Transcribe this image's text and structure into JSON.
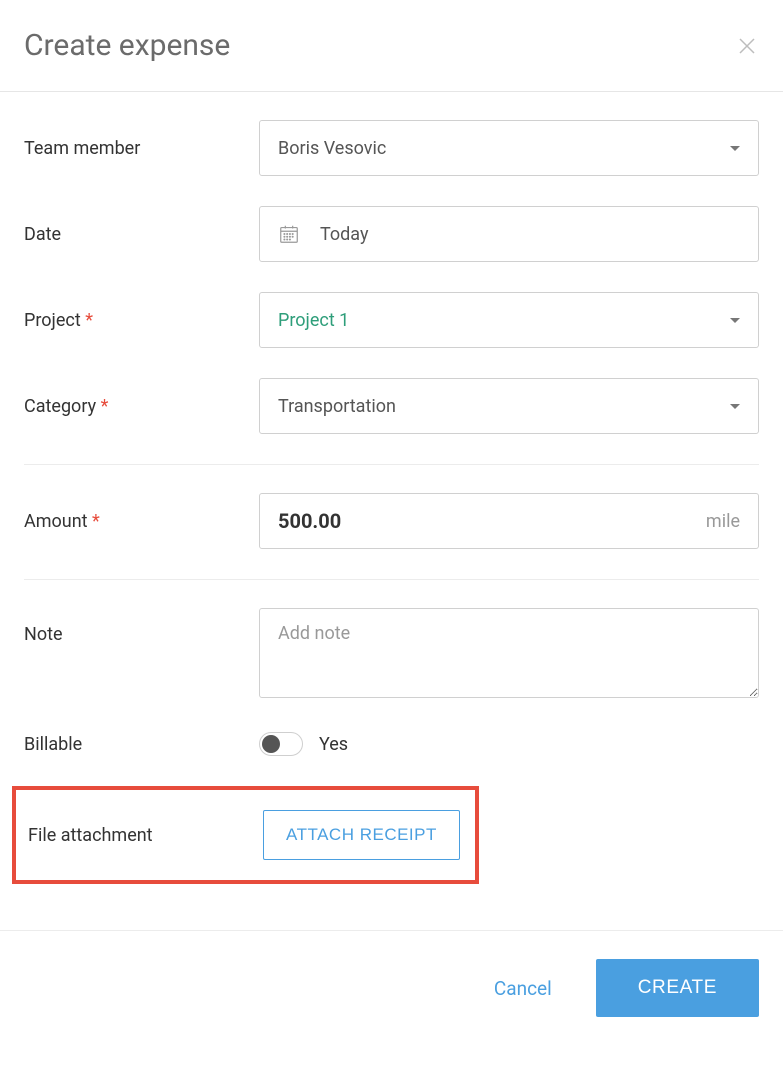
{
  "header": {
    "title": "Create expense"
  },
  "fields": {
    "team_member": {
      "label": "Team member",
      "value": "Boris Vesovic"
    },
    "date": {
      "label": "Date",
      "value": "Today"
    },
    "project": {
      "label": "Project",
      "required_marker": "*",
      "value": "Project 1"
    },
    "category": {
      "label": "Category",
      "required_marker": "*",
      "value": "Transportation"
    },
    "amount": {
      "label": "Amount",
      "required_marker": "*",
      "value": "500.00",
      "unit": "mile"
    },
    "note": {
      "label": "Note",
      "placeholder": "Add note",
      "value": ""
    },
    "billable": {
      "label": "Billable",
      "value_label": "Yes"
    },
    "attachment": {
      "label": "File attachment",
      "button": "ATTACH RECEIPT"
    }
  },
  "footer": {
    "cancel": "Cancel",
    "create": "CREATE"
  }
}
